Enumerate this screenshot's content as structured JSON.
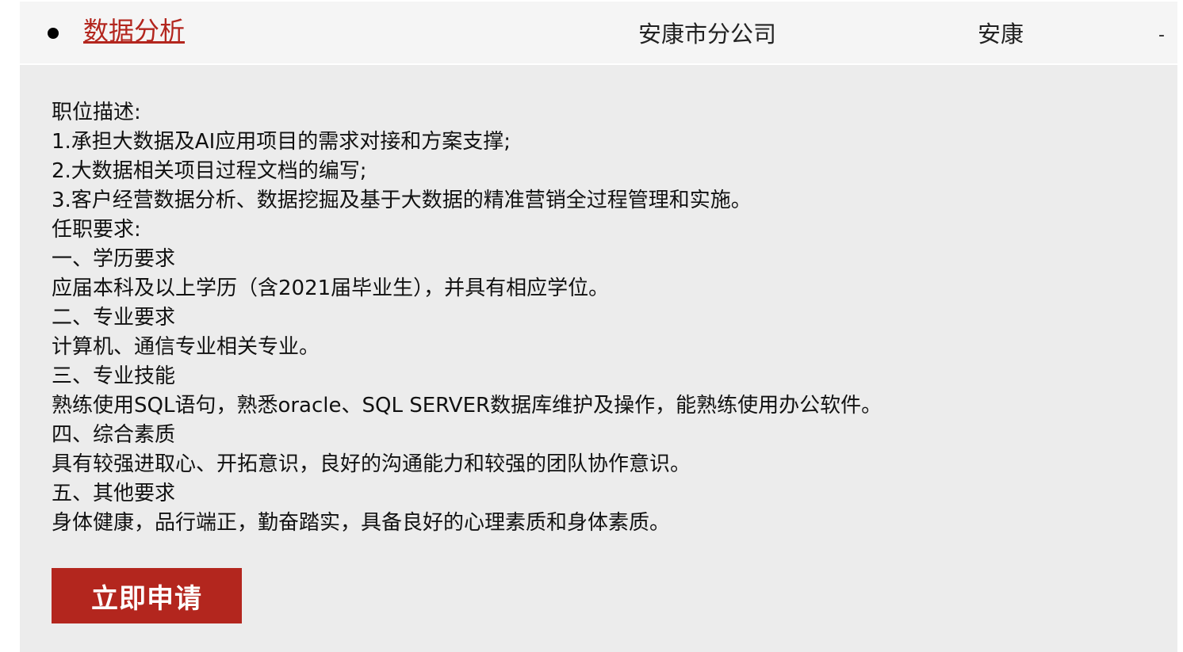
{
  "job": {
    "title": "数据分析",
    "company": "安康市分公司",
    "city": "安康",
    "extra": "-"
  },
  "description_lines": [
    "职位描述:",
    "1.承担大数据及AI应用项目的需求对接和方案支撑;",
    "2.大数据相关项目过程文档的编写;",
    "3.客户经营数据分析、数据挖掘及基于大数据的精准营销全过程管理和实施。",
    "任职要求:",
    "一、学历要求",
    "应届本科及以上学历（含2021届毕业生），并具有相应学位。",
    "二、专业要求",
    "计算机、通信专业相关专业。",
    "三、专业技能",
    "熟练使用SQL语句，熟悉oracle、SQL SERVER数据库维护及操作，能熟练使用办公软件。",
    "四、综合素质",
    "具有较强进取心、开拓意识，良好的沟通能力和较强的团队协作意识。",
    "五、其他要求",
    "身体健康，品行端正，勤奋踏实，具备良好的心理素质和身体素质。"
  ],
  "apply_button": {
    "label": "立即申请"
  },
  "colors": {
    "accent": "#b3261e",
    "row_bg": "#f5f5f5",
    "detail_bg": "#ececec"
  }
}
